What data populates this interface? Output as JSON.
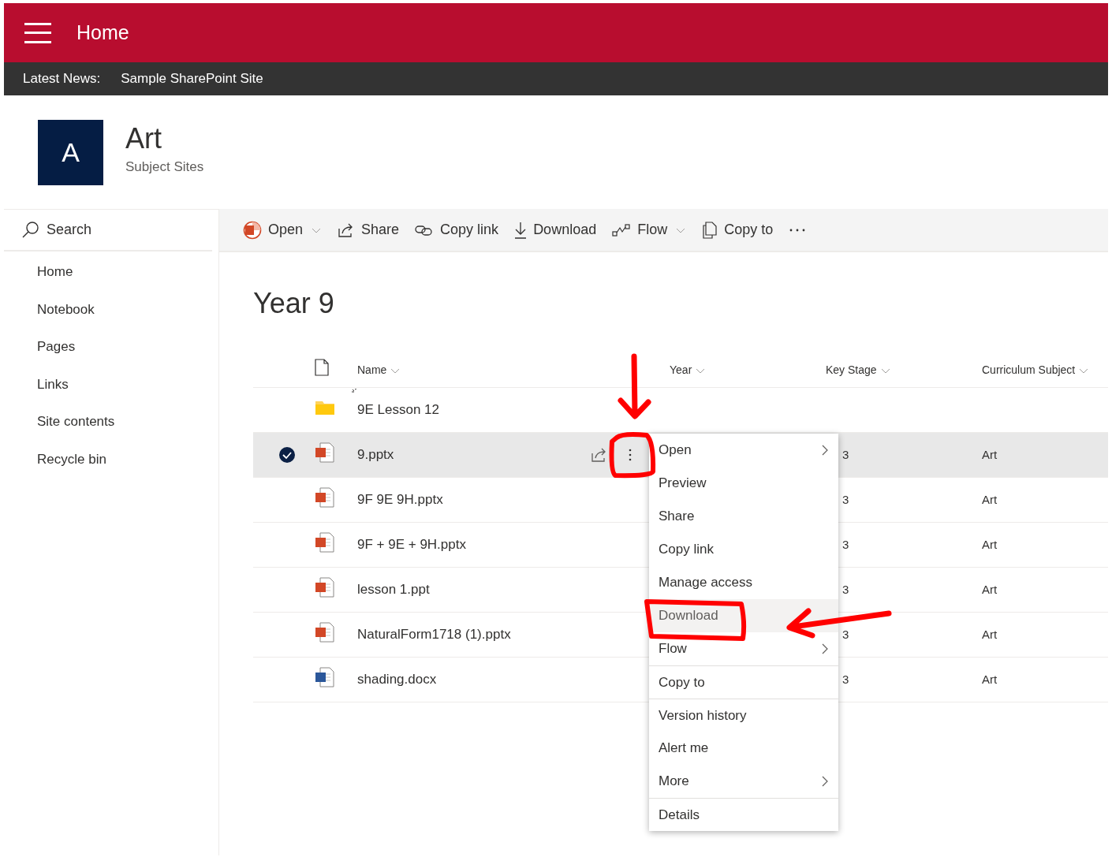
{
  "header": {
    "title": "Home"
  },
  "news_bar": {
    "label": "Latest News:",
    "link": "Sample SharePoint Site"
  },
  "site": {
    "logo_letter": "A",
    "title": "Art",
    "subtitle": "Subject Sites"
  },
  "sidebar": {
    "search_placeholder": "Search",
    "items": [
      {
        "label": "Home"
      },
      {
        "label": "Notebook"
      },
      {
        "label": "Pages"
      },
      {
        "label": "Links"
      },
      {
        "label": "Site contents"
      },
      {
        "label": "Recycle bin"
      }
    ]
  },
  "toolbar": [
    {
      "label": "Open",
      "dropdown": true
    },
    {
      "label": "Share",
      "dropdown": false
    },
    {
      "label": "Copy link",
      "dropdown": false
    },
    {
      "label": "Download",
      "dropdown": false
    },
    {
      "label": "Flow",
      "dropdown": true
    },
    {
      "label": "Copy to",
      "dropdown": false
    }
  ],
  "library": {
    "title": "Year 9",
    "columns": [
      {
        "label": "Name"
      },
      {
        "label": "Year"
      },
      {
        "label": "Key Stage"
      },
      {
        "label": "Curriculum Subject"
      }
    ],
    "rows": [
      {
        "kind": "folder",
        "name": "9E Lesson 12",
        "selected": false,
        "new": true
      },
      {
        "kind": "pptx",
        "name": "9.pptx",
        "selected": true,
        "new": false,
        "key_stage": "3",
        "subject": "Art"
      },
      {
        "kind": "pptx",
        "name": "9F 9E 9H.pptx",
        "selected": false,
        "new": false,
        "key_stage": "3",
        "subject": "Art"
      },
      {
        "kind": "pptx",
        "name": "9F + 9E + 9H.pptx",
        "selected": false,
        "new": false,
        "key_stage": "3",
        "subject": "Art"
      },
      {
        "kind": "pptx",
        "name": "lesson 1.ppt",
        "selected": false,
        "new": false,
        "key_stage": "3",
        "subject": "Art"
      },
      {
        "kind": "pptx",
        "name": "NaturalForm1718 (1).pptx",
        "selected": false,
        "new": false,
        "key_stage": "3",
        "subject": "Art"
      },
      {
        "kind": "docx",
        "name": "shading.docx",
        "selected": false,
        "new": false,
        "key_stage": "3",
        "subject": "Art"
      }
    ]
  },
  "context_menu": [
    {
      "label": "Open",
      "submenu": true,
      "divider_before": false,
      "hovered": false
    },
    {
      "label": "Preview",
      "submenu": false,
      "divider_before": false,
      "hovered": false
    },
    {
      "label": "Share",
      "submenu": false,
      "divider_before": false,
      "hovered": false
    },
    {
      "label": "Copy link",
      "submenu": false,
      "divider_before": false,
      "hovered": false
    },
    {
      "label": "Manage access",
      "submenu": false,
      "divider_before": false,
      "hovered": false
    },
    {
      "label": "Download",
      "submenu": false,
      "divider_before": false,
      "hovered": true
    },
    {
      "label": "Flow",
      "submenu": true,
      "divider_before": false,
      "hovered": false
    },
    {
      "label": "Copy to",
      "submenu": false,
      "divider_before": true,
      "hovered": false
    },
    {
      "label": "Version history",
      "submenu": false,
      "divider_before": true,
      "hovered": false
    },
    {
      "label": "Alert me",
      "submenu": false,
      "divider_before": false,
      "hovered": false
    },
    {
      "label": "More",
      "submenu": true,
      "divider_before": false,
      "hovered": false
    },
    {
      "label": "Details",
      "submenu": false,
      "divider_before": true,
      "hovered": false
    }
  ]
}
